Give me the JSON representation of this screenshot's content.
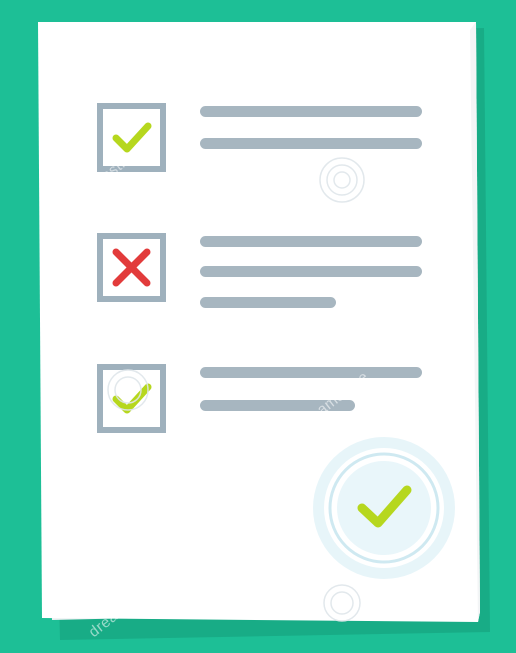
{
  "colors": {
    "background": "#1dbf96",
    "background_shadow": "#159e7d",
    "paper": "#ffffff",
    "paper_shadow": "#e9ecee",
    "box_border": "#9fb1bd",
    "line": "#a7b6c0",
    "check": "#b6d71e",
    "cross": "#e23b3b",
    "stamp_ring": "#d9eef4",
    "stamp_inner": "#ffffff"
  },
  "checklist": {
    "items": [
      {
        "status": "checked",
        "icon": "checkmark-icon",
        "line_fractions": [
          1.0,
          1.0
        ]
      },
      {
        "status": "rejected",
        "icon": "cross-icon",
        "line_fractions": [
          1.0,
          1.0,
          0.61
        ]
      },
      {
        "status": "checked",
        "icon": "checkmark-icon",
        "line_fractions": [
          1.0,
          0.7
        ]
      }
    ]
  },
  "approval_stamp": {
    "icon": "checkmark-icon"
  },
  "watermark": {
    "text": "dreamstime"
  }
}
